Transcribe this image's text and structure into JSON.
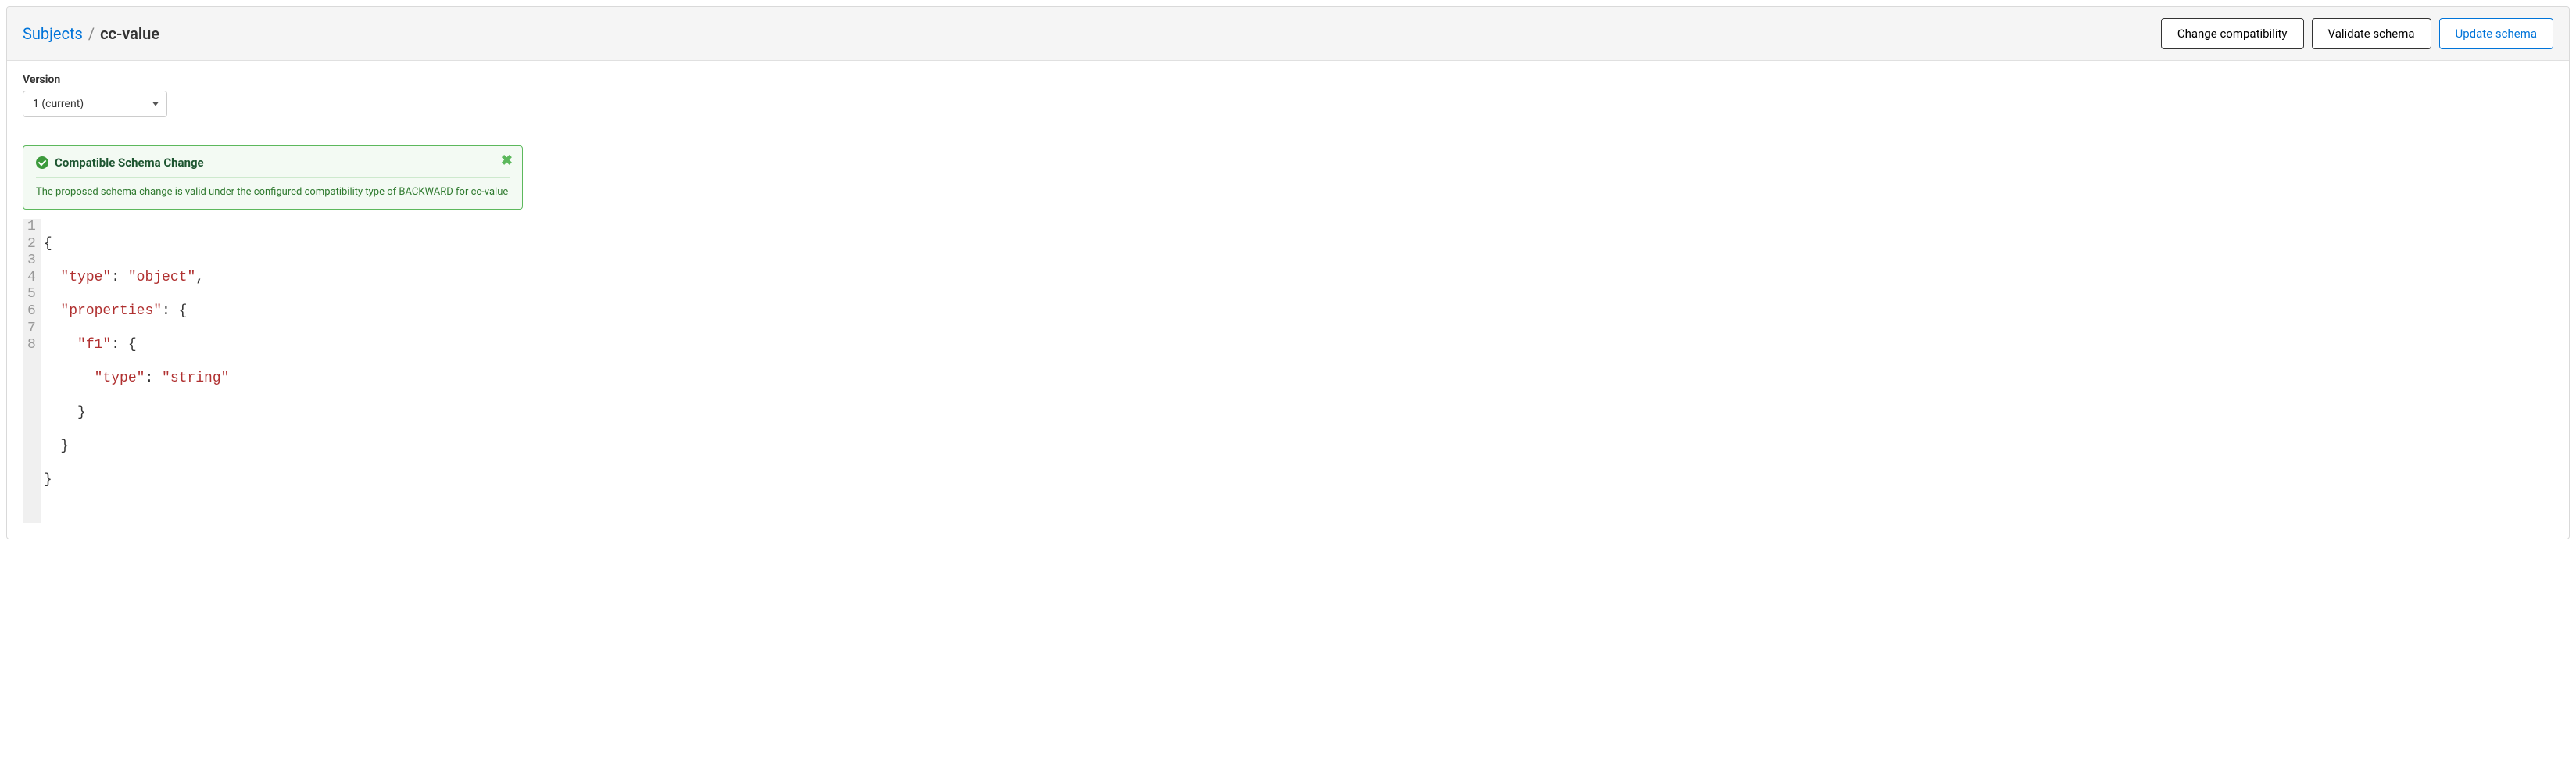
{
  "breadcrumb": {
    "root": "Subjects",
    "sep": "/",
    "current": "cc-value"
  },
  "actions": {
    "change": "Change compatibility",
    "validate": "Validate schema",
    "update": "Update schema"
  },
  "version": {
    "label": "Version",
    "value": "1 (current)"
  },
  "alert": {
    "title": "Compatible Schema Change",
    "message": "The proposed schema change is valid under the configured compatibility type of BACKWARD for cc-value"
  },
  "code": {
    "l1": "{",
    "l2a": "\"type\"",
    "l2b": ": ",
    "l2c": "\"object\"",
    "l2d": ",",
    "l3a": "\"properties\"",
    "l3b": ": {",
    "l4a": "\"f1\"",
    "l4b": ": {",
    "l5a": "\"type\"",
    "l5b": ": ",
    "l5c": "\"string\"",
    "l6": "}",
    "l7": "}",
    "l8": "}",
    "ln": {
      "1": "1",
      "2": "2",
      "3": "3",
      "4": "4",
      "5": "5",
      "6": "6",
      "7": "7",
      "8": "8"
    }
  }
}
